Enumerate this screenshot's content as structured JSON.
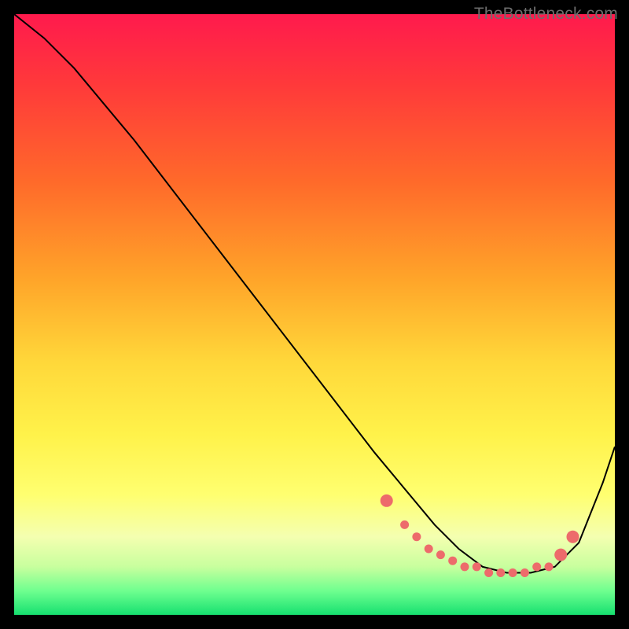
{
  "watermark": "TheBottleneck.com",
  "chart_data": {
    "type": "line",
    "title": "",
    "xlabel": "",
    "ylabel": "",
    "xlim": [
      0,
      100
    ],
    "ylim": [
      0,
      100
    ],
    "curve": {
      "name": "bottleneck-curve",
      "x": [
        0,
        5,
        10,
        20,
        30,
        40,
        50,
        60,
        65,
        70,
        74,
        78,
        82,
        86,
        90,
        94,
        98,
        100
      ],
      "y": [
        100,
        96,
        91,
        79,
        66,
        53,
        40,
        27,
        21,
        15,
        11,
        8,
        7,
        7,
        8,
        12,
        22,
        28
      ]
    },
    "marked_region": {
      "name": "optimal-zone-dots",
      "x": [
        62,
        65,
        67,
        69,
        71,
        73,
        75,
        77,
        79,
        81,
        83,
        85,
        87,
        89,
        91,
        93
      ],
      "y": [
        19,
        15,
        13,
        11,
        10,
        9,
        8,
        8,
        7,
        7,
        7,
        7,
        8,
        8,
        10,
        13
      ]
    }
  }
}
